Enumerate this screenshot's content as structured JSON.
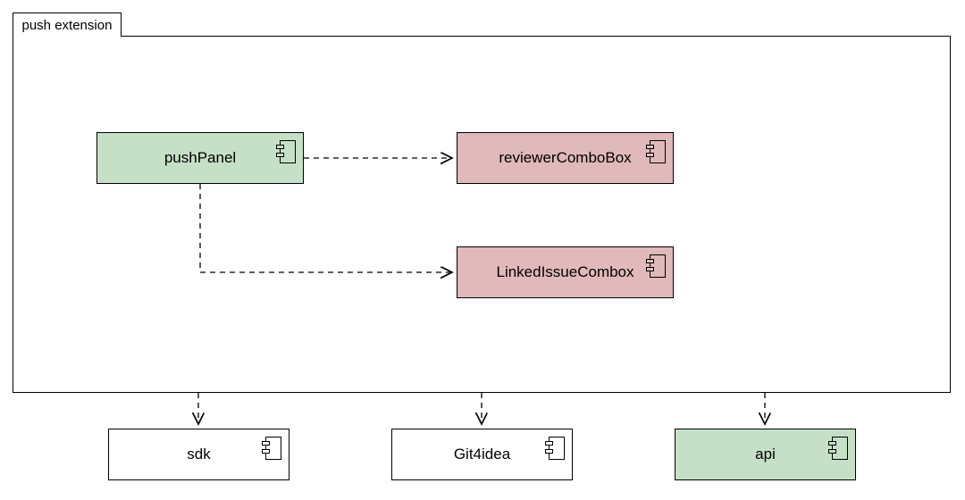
{
  "package": {
    "label": "push extension"
  },
  "components": {
    "pushPanel": {
      "label": "pushPanel"
    },
    "reviewerComboBox": {
      "label": "reviewerComboBox"
    },
    "linkedIssueCombox": {
      "label": "LinkedIssueCombox"
    },
    "sdk": {
      "label": "sdk"
    },
    "git4idea": {
      "label": "Git4idea"
    },
    "api": {
      "label": "api"
    }
  },
  "chart_data": {
    "type": "diagram",
    "title": "push extension",
    "nodes": [
      {
        "id": "push_extension",
        "label": "push extension",
        "kind": "package"
      },
      {
        "id": "pushPanel",
        "label": "pushPanel",
        "kind": "component",
        "parent": "push_extension",
        "color": "green"
      },
      {
        "id": "reviewerComboBox",
        "label": "reviewerComboBox",
        "kind": "component",
        "parent": "push_extension",
        "color": "pink"
      },
      {
        "id": "LinkedIssueCombox",
        "label": "LinkedIssueCombox",
        "kind": "component",
        "parent": "push_extension",
        "color": "pink"
      },
      {
        "id": "sdk",
        "label": "sdk",
        "kind": "component",
        "color": "white"
      },
      {
        "id": "Git4idea",
        "label": "Git4idea",
        "kind": "component",
        "color": "white"
      },
      {
        "id": "api",
        "label": "api",
        "kind": "component",
        "color": "green"
      }
    ],
    "edges": [
      {
        "from": "pushPanel",
        "to": "reviewerComboBox",
        "style": "dashed-arrow"
      },
      {
        "from": "pushPanel",
        "to": "LinkedIssueCombox",
        "style": "dashed-arrow"
      },
      {
        "from": "push_extension",
        "to": "sdk",
        "style": "dashed-arrow"
      },
      {
        "from": "push_extension",
        "to": "Git4idea",
        "style": "dashed-arrow"
      },
      {
        "from": "push_extension",
        "to": "api",
        "style": "dashed-arrow"
      }
    ]
  }
}
